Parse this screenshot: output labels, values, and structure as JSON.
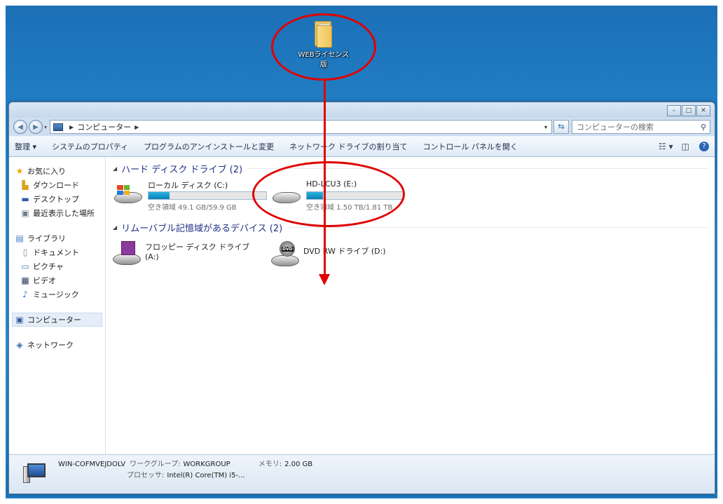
{
  "desktop": {
    "icon_label": "WEBライセンス版"
  },
  "window": {
    "caption": {
      "minimize": "–",
      "maximize": "□",
      "close": "✕"
    },
    "address": {
      "crumb": "コンピューター",
      "search_placeholder": "コンピューターの検索"
    },
    "toolbar": {
      "organize": "整理 ▾",
      "system_properties": "システムのプロパティ",
      "uninstall": "プログラムのアンインストールと変更",
      "map_drive": "ネットワーク ドライブの割り当て",
      "control_panel": "コントロール パネルを開く"
    },
    "nav": {
      "favorites": {
        "label": "お気に入り",
        "items": [
          "ダウンロード",
          "デスクトップ",
          "最近表示した場所"
        ]
      },
      "libraries": {
        "label": "ライブラリ",
        "items": [
          "ドキュメント",
          "ピクチャ",
          "ビデオ",
          "ミュージック"
        ]
      },
      "computer": "コンピューター",
      "network": "ネットワーク"
    },
    "sections": {
      "hard_drives": "ハード ディスク ドライブ (2)",
      "removable": "リムーバブル記憶域があるデバイス (2)"
    },
    "drives": [
      {
        "name": "ローカル ディスク (C:)",
        "space": "空き領域 49.1 GB/59.9 GB",
        "used_fraction": 0.18
      },
      {
        "name": "HD-LCU3 (E:)",
        "space": "空き領域 1.50 TB/1.81 TB",
        "used_fraction": 0.17
      }
    ],
    "removable_devices": [
      {
        "name": "フロッピー ディスク ドライブ (A:)"
      },
      {
        "name": "DVD RW ドライブ (D:)"
      }
    ],
    "details": {
      "computer_name": "WIN-COFMVEJDOLV",
      "workgroup_label": "ワークグループ:",
      "workgroup": "WORKGROUP",
      "memory_label": "メモリ:",
      "memory": "2.00 GB",
      "processor_label": "プロセッサ:",
      "processor": "Intel(R) Core(TM) i5-..."
    }
  }
}
